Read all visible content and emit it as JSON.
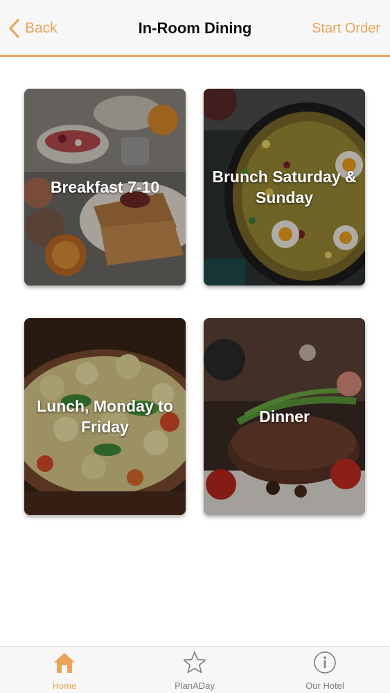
{
  "header": {
    "back_label": "Back",
    "title": "In-Room Dining",
    "action_label": "Start Order"
  },
  "tiles": [
    {
      "label": "Breakfast 7-10"
    },
    {
      "label": "Brunch Saturday & Sunday"
    },
    {
      "label": "Lunch, Monday to Friday"
    },
    {
      "label": "Dinner"
    }
  ],
  "tabbar": {
    "items": [
      {
        "label": "Home",
        "icon": "home-icon",
        "active": true
      },
      {
        "label": "PlanADay",
        "icon": "star-icon",
        "active": false
      },
      {
        "label": "Our Hotel",
        "icon": "info-icon",
        "active": false
      }
    ]
  },
  "colors": {
    "accent": "#e9a45a",
    "inactive": "#7b7b7b"
  }
}
